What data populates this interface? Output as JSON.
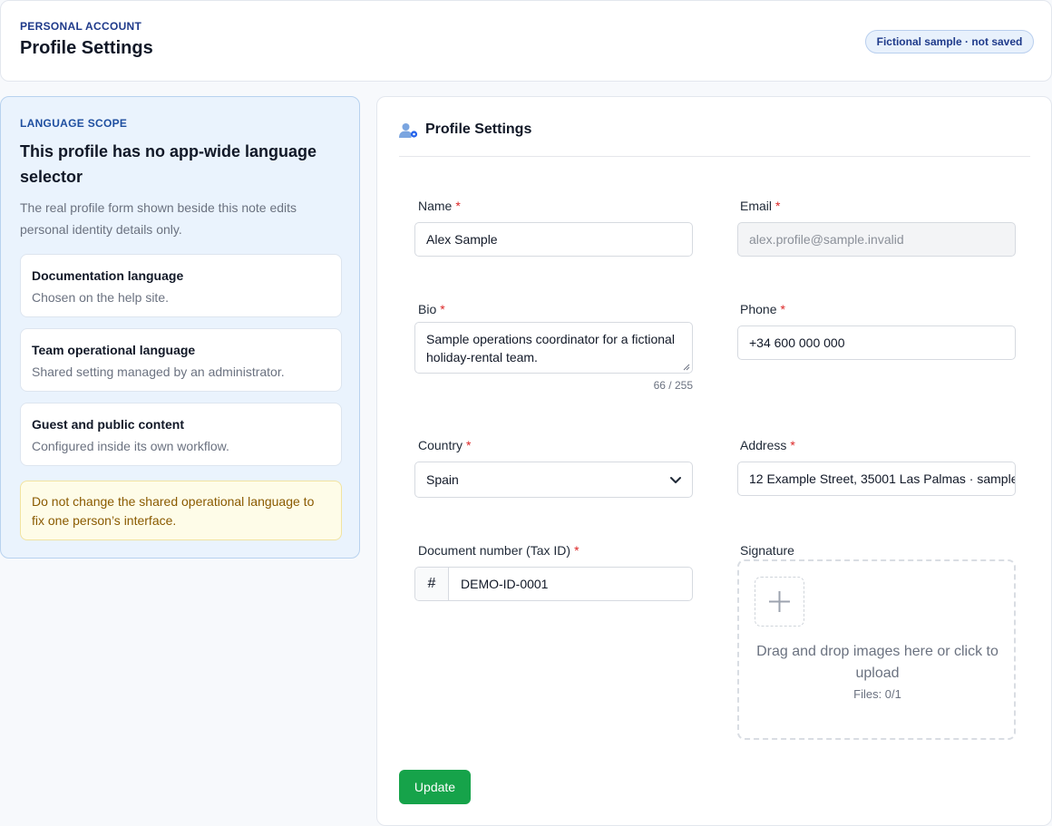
{
  "header": {
    "eyebrow": "PERSONAL ACCOUNT",
    "title": "Profile Settings",
    "badge": "Fictional sample · not saved"
  },
  "scope": {
    "eyebrow": "LANGUAGE SCOPE",
    "heading": "This profile has no app-wide language selector",
    "intro": "The real profile form shown beside this note edits personal identity details only.",
    "items": [
      {
        "title": "Documentation language",
        "desc": "Chosen on the help site."
      },
      {
        "title": "Team operational language",
        "desc": "Shared setting managed by an administrator."
      },
      {
        "title": "Guest and public content",
        "desc": "Configured inside its own workflow."
      }
    ],
    "warning": "Do not change the shared operational language to fix one person’s interface."
  },
  "form": {
    "title": "Profile Settings",
    "required_mark": "*",
    "name": {
      "label": "Name",
      "value": "Alex Sample"
    },
    "email": {
      "label": "Email",
      "value": "alex.profile@sample.invalid"
    },
    "bio": {
      "label": "Bio",
      "value": "Sample operations coordinator for a fictional holiday-rental team.",
      "counter": "66 / 255"
    },
    "phone": {
      "label": "Phone",
      "value": "+34 600 000 000"
    },
    "country": {
      "label": "Country",
      "value": "Spain"
    },
    "address": {
      "label": "Address",
      "value": "12 Example Street, 35001 Las Palmas · sample"
    },
    "document": {
      "label": "Document number (Tax ID)",
      "prefix": "#",
      "value": "DEMO-ID-0001"
    },
    "signature": {
      "label": "Signature",
      "hint": "Drag and drop images here or click to upload",
      "files": "Files: 0/1"
    },
    "submit_label": "Update"
  },
  "icons": {
    "header": "user-gear-icon",
    "country_toggle": "chevron-down-icon",
    "upload": "plus-icon",
    "document_prefix": "hash-icon"
  },
  "colors": {
    "accent": "#16a34a",
    "required": "#dc2626",
    "brand": "#1f3a8a"
  }
}
